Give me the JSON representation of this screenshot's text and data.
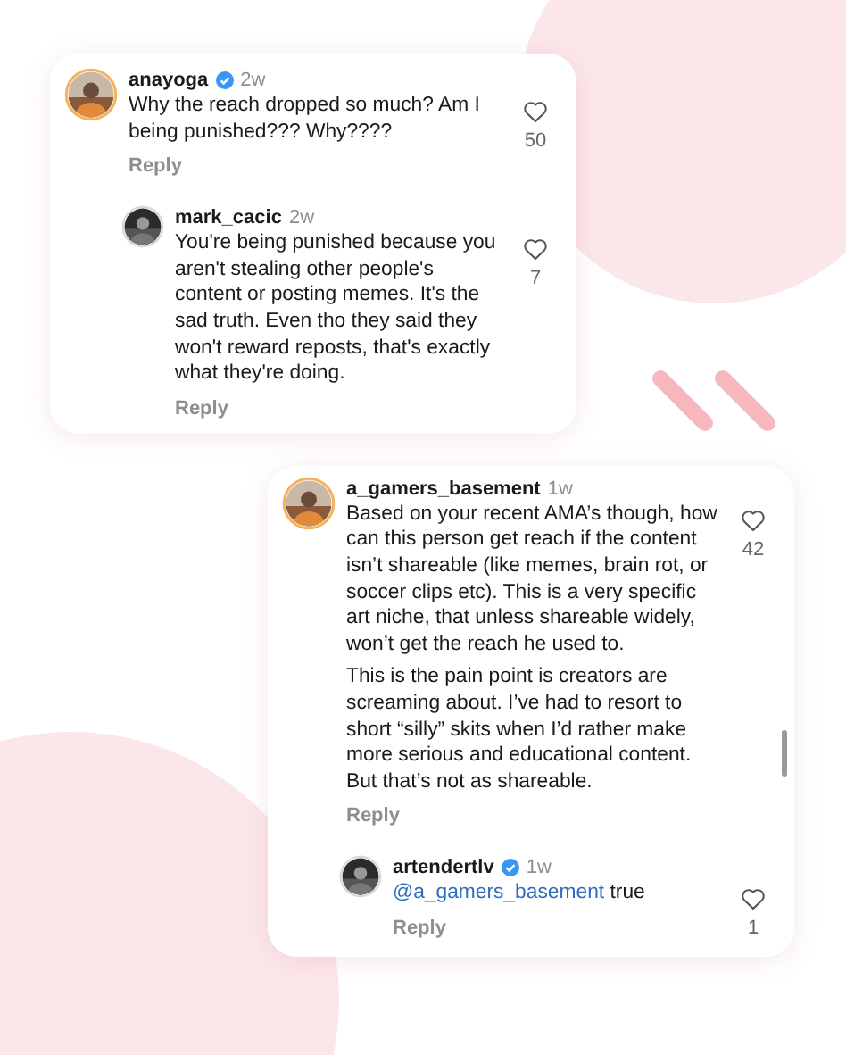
{
  "cards": [
    {
      "comments": [
        {
          "kind": "comment",
          "username": "anayoga",
          "verified": true,
          "time": "2w",
          "paragraphs": [
            "Why the reach dropped so much? Am I being punished??? Why????"
          ],
          "reply_label": "Reply",
          "likes": "50"
        },
        {
          "kind": "reply",
          "username": "mark_cacic",
          "verified": false,
          "time": "2w",
          "paragraphs": [
            "You're being punished because you aren't stealing other people's content or posting memes. It's the sad truth. Even tho they said they won't reward reposts, that's exactly what they're doing."
          ],
          "reply_label": "Reply",
          "likes": "7"
        }
      ]
    },
    {
      "comments": [
        {
          "kind": "comment",
          "username": "a_gamers_basement",
          "verified": false,
          "time": "1w",
          "paragraphs": [
            "Based on your recent AMA’s though, how can this person get reach if the content isn’t shareable (like memes, brain rot, or soccer clips etc). This is a very specific art niche, that unless shareable widely, won’t get the reach he used to.",
            "This is the pain point is creators are screaming about. I’ve had to resort to short “silly” skits when I’d rather make more serious and educational content. But that’s not as shareable."
          ],
          "reply_label": "Reply",
          "likes": "42"
        },
        {
          "kind": "reply",
          "username": "artendertlv",
          "verified": true,
          "time": "1w",
          "mention": "@a_gamers_basement",
          "paragraphs": [
            "true"
          ],
          "reply_label": "Reply",
          "likes": "1"
        }
      ]
    }
  ]
}
